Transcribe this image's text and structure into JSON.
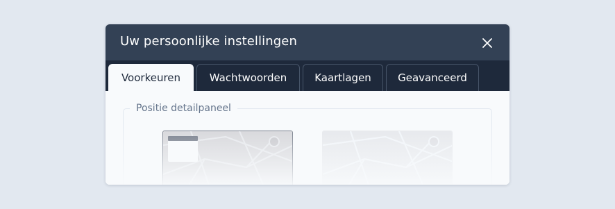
{
  "dialog": {
    "title": "Uw persoonlijke instellingen",
    "close_icon": "close-icon"
  },
  "tabs": [
    {
      "label": "Voorkeuren",
      "active": true
    },
    {
      "label": "Wachtwoorden",
      "active": false
    },
    {
      "label": "Kaartlagen",
      "active": false
    },
    {
      "label": "Geavanceerd",
      "active": false
    }
  ],
  "preferences": {
    "section_legend": "Positie detailpaneel",
    "options": [
      {
        "icon": "map-with-panel-icon",
        "selected": true
      },
      {
        "icon": "map-icon",
        "selected": false
      }
    ]
  },
  "colors": {
    "header": "#334155",
    "tabbar": "#1e293b",
    "page_background": "#e2e8f0",
    "panel_background": "#f8fafc"
  }
}
